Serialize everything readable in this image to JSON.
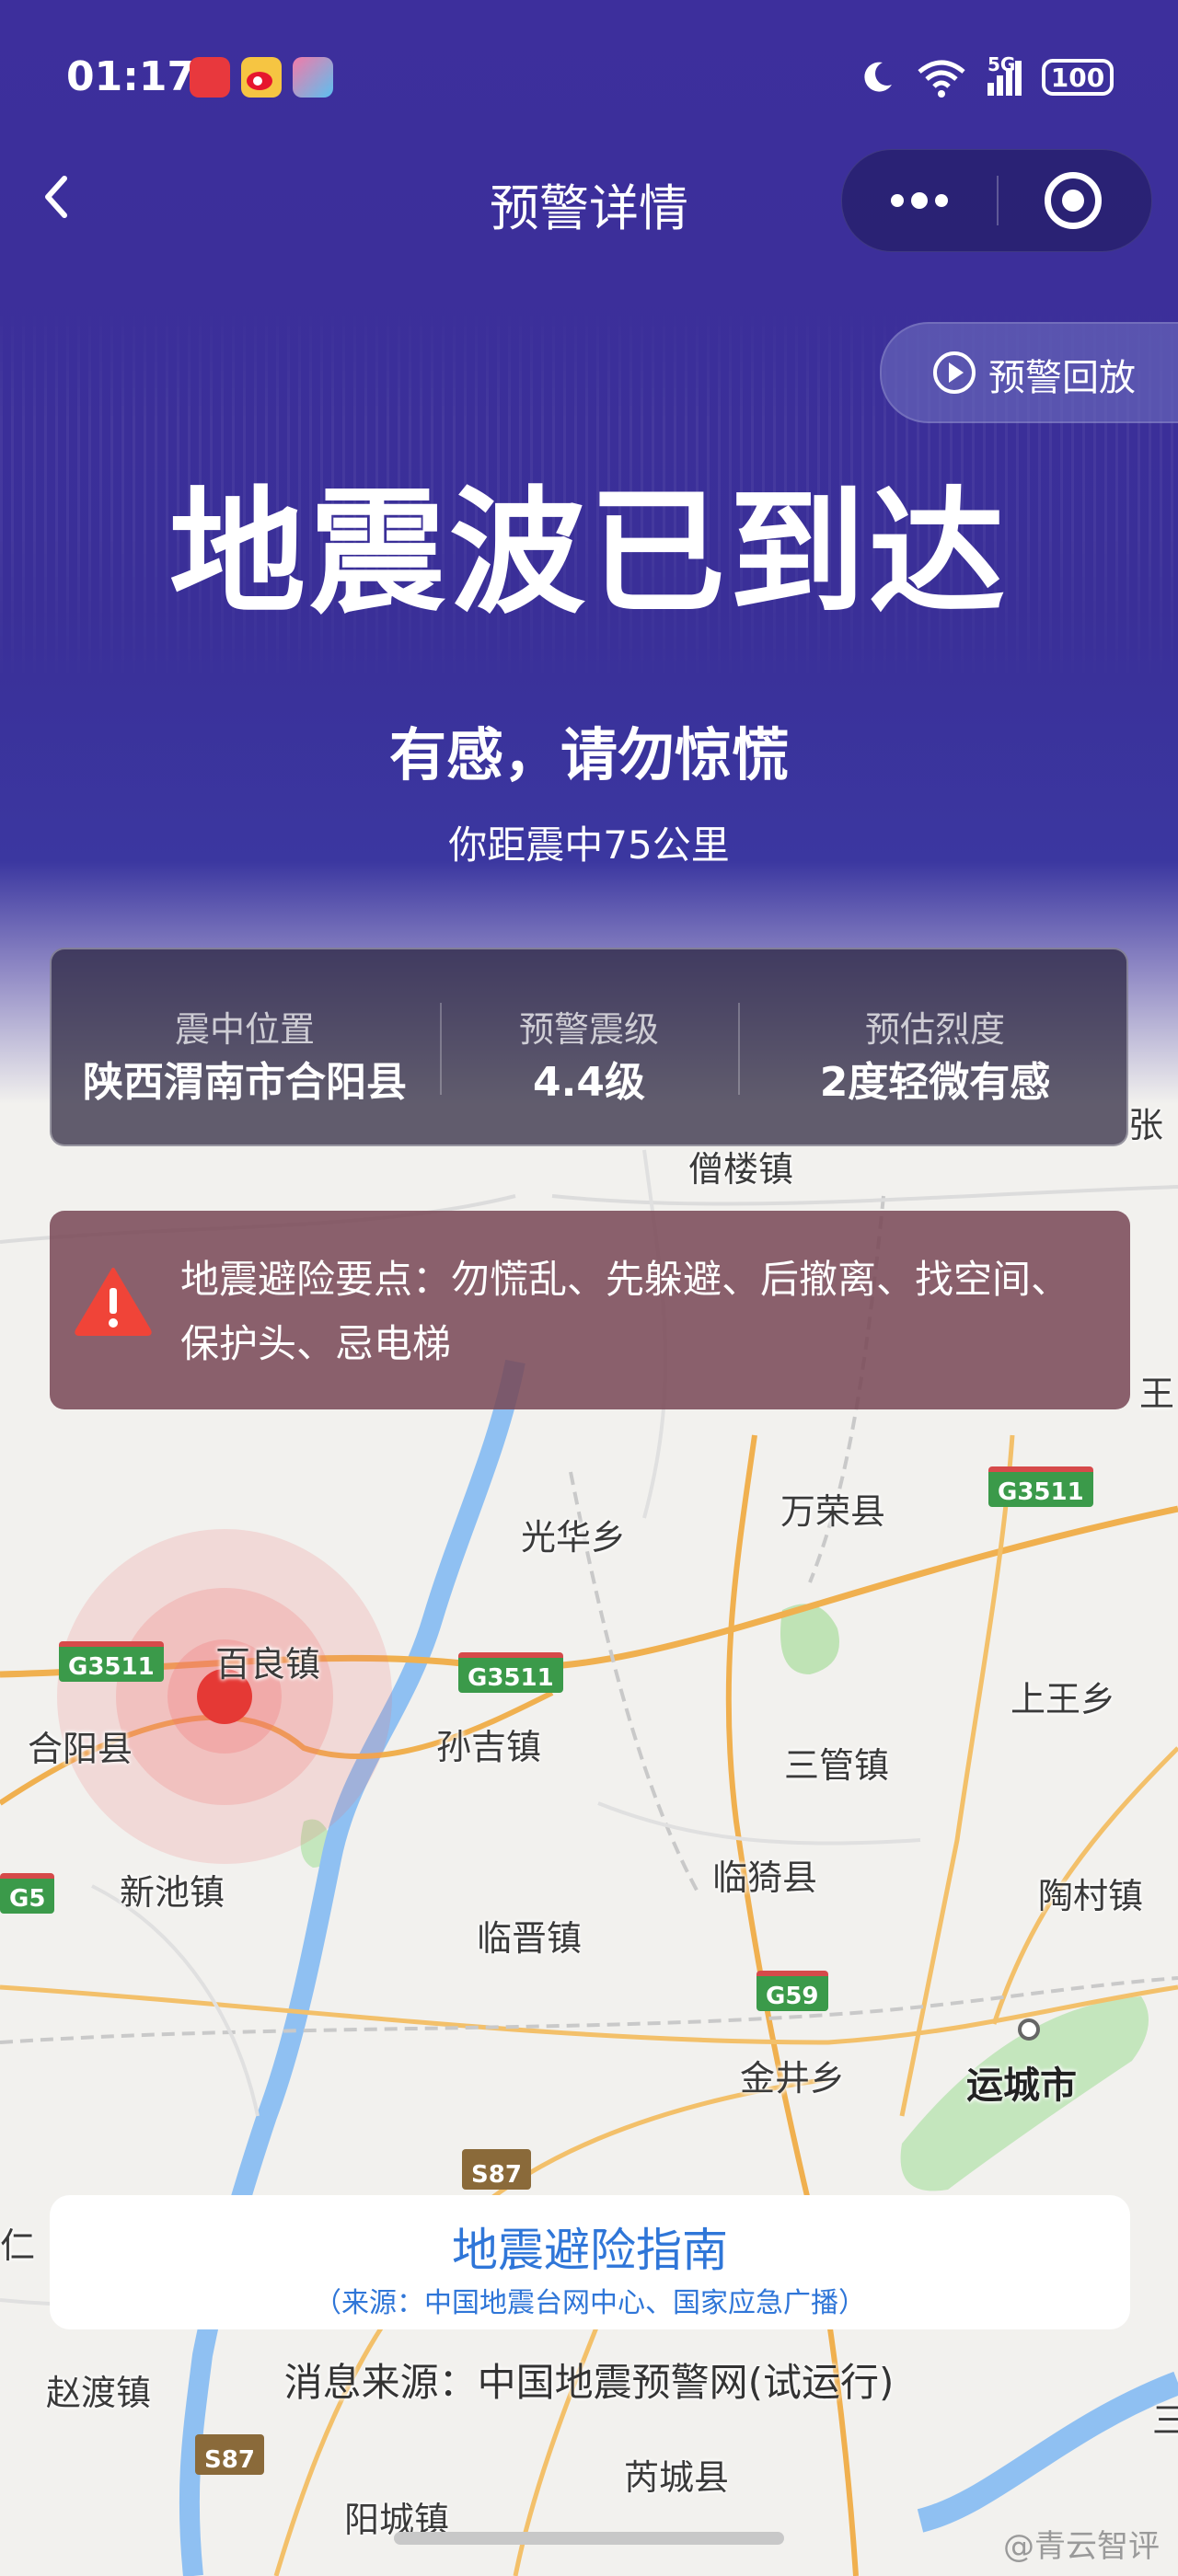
{
  "status_bar": {
    "time": "01:17",
    "network": "5G",
    "battery": "100",
    "app_icons": [
      "xiaohongshu-icon",
      "weibo-icon",
      "game-icon"
    ]
  },
  "nav": {
    "title": "预警详情"
  },
  "replay": {
    "label": "预警回放"
  },
  "alert": {
    "headline": "地震波已到达",
    "subline": "有感，请勿惊慌",
    "distance": "你距震中75公里"
  },
  "info": {
    "epicenter_label": "震中位置",
    "epicenter_value": "陕西渭南市合阳县",
    "magnitude_label": "预警震级",
    "magnitude_value": "4.4级",
    "intensity_label": "预估烈度",
    "intensity_value": "2度轻微有感"
  },
  "tips": {
    "text": "地震避险要点：勿慌乱、先躲避、后撤离、找空间、保护头、忌电梯"
  },
  "map": {
    "labels": {
      "zengloU": "僧楼镇",
      "zhang": "张",
      "wang": "王",
      "guanghua": "光华乡",
      "wanrong": "万荣县",
      "bailiang": "百良镇",
      "heyang": "合阳县",
      "sunji": "孙吉镇",
      "shangwang": "上王乡",
      "sanguan": "三管镇",
      "xinchi": "新池镇",
      "linyi": "临猗县",
      "taocun": "陶村镇",
      "linjin": "临晋镇",
      "jinjing": "金井乡",
      "yuncheng": "运城市",
      "ren": "仁",
      "zhaodu": "赵渡镇",
      "ruicheng": "芮城县",
      "yangcheng": "阳城镇",
      "san": "三"
    },
    "shields": {
      "g3511_a": "G3511",
      "g3511_b": "G3511",
      "g3511_c": "G3511",
      "g5": "G5",
      "g59": "G59",
      "s87_a": "S87",
      "s87_b": "S87"
    }
  },
  "guide": {
    "title": "地震避险指南",
    "source": "（来源：中国地震台网中心、国家应急广播）"
  },
  "message_source": "消息来源：中国地震预警网(试运行)",
  "watermark": "@青云智评",
  "colors": {
    "header": "#3d2f9c",
    "link_blue": "#2f76d8",
    "epicenter_red": "#e53935"
  }
}
